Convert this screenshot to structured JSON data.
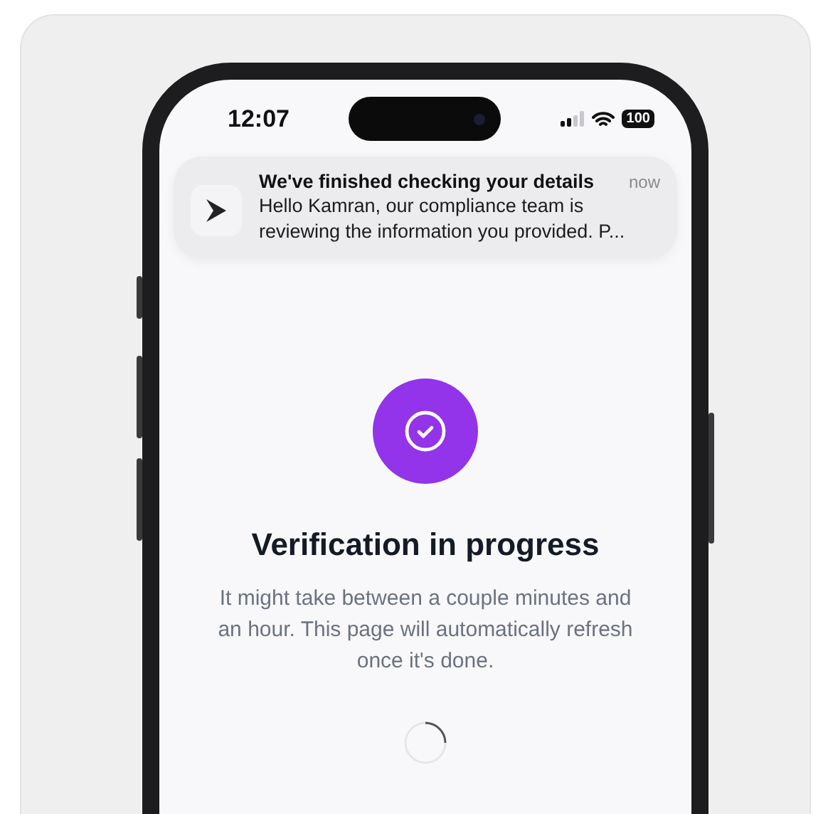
{
  "status_bar": {
    "time": "12:07",
    "battery": "100"
  },
  "notification": {
    "title": "We've finished checking your details",
    "time": "now",
    "body": "Hello Kamran, our compliance team is reviewing the information you provided. P..."
  },
  "verification": {
    "title": "Verification in progress",
    "description": "It might take between a couple minutes and an hour. This page will automatically refresh once it's done."
  }
}
